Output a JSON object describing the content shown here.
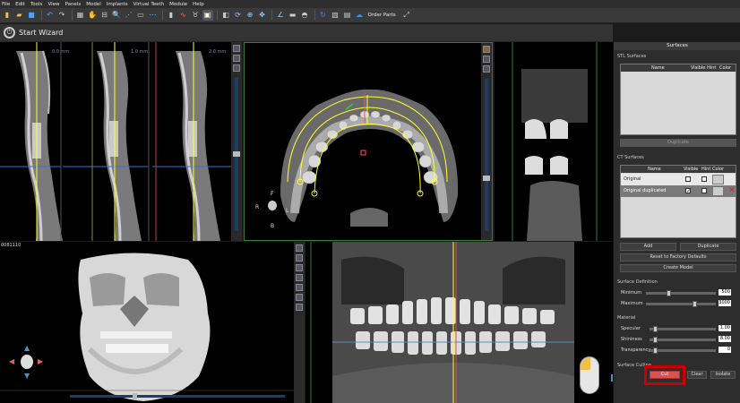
{
  "menu": {
    "items": [
      "File",
      "Edit",
      "Tools",
      "View",
      "Panels",
      "Model",
      "Implants",
      "Virtual Teeth",
      "Module",
      "Help"
    ]
  },
  "toolbar": {
    "order_label": "Order Parts"
  },
  "wizard": {
    "label": "Start Wizard"
  },
  "views": {
    "slice_labels": [
      "0.0 mm",
      "1.0 mm",
      "2.0 mm"
    ],
    "patient_id": "0081110",
    "orient": {
      "front": "F",
      "right": "R",
      "left": "L",
      "bottom": "B"
    }
  },
  "panel": {
    "title": "Surfaces",
    "stl": {
      "title": "STL Surfaces",
      "columns": [
        "Name",
        "Visible",
        "Hint",
        "Color"
      ],
      "duplicate_label": "Duplicate"
    },
    "ct": {
      "title": "CT Surfaces",
      "columns": [
        "Name",
        "Visible",
        "Hint",
        "Color"
      ],
      "rows": [
        {
          "name": "Original",
          "visible": false,
          "hint": false
        },
        {
          "name": "Original duplicated",
          "visible": true,
          "hint": false
        }
      ],
      "add_label": "Add",
      "duplicate_label": "Duplicate",
      "reset_label": "Reset to Factory Defaults",
      "create_model_label": "Create Model"
    },
    "surface_def": {
      "title": "Surface Definition",
      "minimum_label": "Minimum",
      "minimum_value": "500",
      "minimum_frac": 0.28,
      "maximum_label": "Maximum",
      "maximum_value": "3000",
      "maximum_frac": 0.66
    },
    "material": {
      "title": "Material",
      "specular_label": "Specular",
      "specular_value": "1.00",
      "specular_frac": 0.05,
      "shininess_label": "Shininess",
      "shininess_value": "8.00",
      "shininess_frac": 0.05,
      "transparency_label": "Transparency",
      "transparency_value": "0",
      "transparency_frac": 0.05
    },
    "culling": {
      "title": "Surface Culling",
      "cut_label": "Cut",
      "clear_label": "Clear",
      "isolate_label": "Isolate"
    }
  },
  "colors": {
    "accent_red": "#cc0000",
    "cut_button": "#d9534f",
    "yellow_curve": "#ffff33",
    "arrow_blue": "#4a90d9"
  }
}
